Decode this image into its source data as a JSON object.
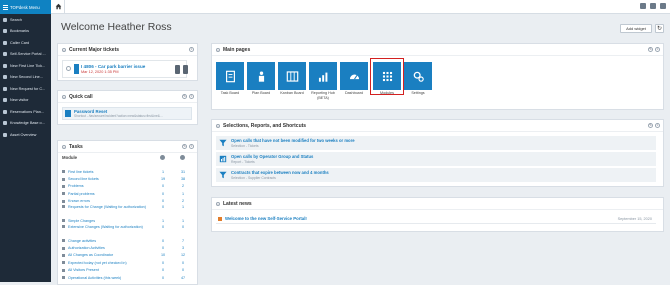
{
  "sidebar": {
    "brand": "TOPdesk Menu",
    "items": [
      {
        "label": "Search",
        "icon": "search-icon"
      },
      {
        "label": "Bookmarks",
        "icon": "bookmark-icon"
      },
      {
        "label": "Caller Card",
        "icon": "card-icon"
      },
      {
        "label": "Self-Service Portal ...",
        "icon": "portal-icon"
      },
      {
        "label": "New First Line Tick...",
        "icon": "ticket-icon"
      },
      {
        "label": "New Second Line...",
        "icon": "ticket-icon"
      },
      {
        "label": "New Request for C...",
        "icon": "request-icon"
      },
      {
        "label": "New visitor",
        "icon": "visitor-icon"
      },
      {
        "label": "Reservations Plan...",
        "icon": "calendar-icon"
      },
      {
        "label": "Knowledge Base o...",
        "icon": "knowledge-icon"
      },
      {
        "label": "Asset Overview",
        "icon": "asset-icon"
      }
    ]
  },
  "header": {
    "title": "Welcome Heather Ross",
    "add_widget": "Add widget"
  },
  "major": {
    "title": "Current Major tickets",
    "ticket_title": "I 4806 - Car park barrier issue",
    "ticket_date": "Mar 12, 2020 1:35 PM"
  },
  "quickcall": {
    "title": "Quick call",
    "item_title": "Password Reset",
    "item_sub": "Shortcut - /tas/secure/incident?action=new&status=firstLine&..."
  },
  "tasks": {
    "title": "Tasks",
    "col_module": "Module",
    "rows": [
      {
        "label": "First line tickets",
        "a": "1",
        "b": "31"
      },
      {
        "label": "Second line tickets",
        "a": "19",
        "b": "38"
      },
      {
        "label": "Problems",
        "a": "0",
        "b": "2"
      },
      {
        "label": "Partial problems",
        "a": "0",
        "b": "1"
      },
      {
        "label": "Known errors",
        "a": "0",
        "b": "2"
      },
      {
        "label": "Requests for Change (Waiting for authorization)",
        "a": "0",
        "b": "1"
      },
      {
        "label": "Simple Changes",
        "a": "1",
        "b": "1"
      },
      {
        "label": "Extensive Changes (Waiting for authorization)",
        "a": "0",
        "b": "0"
      },
      {
        "label": "Change activities",
        "a": "0",
        "b": "7"
      },
      {
        "label": "Authorization Activities",
        "a": "0",
        "b": "3"
      },
      {
        "label": "All Changes as Coordinator",
        "a": "10",
        "b": "12"
      },
      {
        "label": "Expected today (not yet checked in)",
        "a": "0",
        "b": "0"
      },
      {
        "label": "All Visitors Present",
        "a": "0",
        "b": "0"
      },
      {
        "label": "Operational Activities (this week)",
        "a": "0",
        "b": "47"
      }
    ]
  },
  "mainpages": {
    "title": "Main pages",
    "tiles": [
      {
        "label": "Task Board",
        "icon": "task-board-icon"
      },
      {
        "label": "Plan Board",
        "icon": "plan-board-icon"
      },
      {
        "label": "Kanban Board",
        "icon": "kanban-icon"
      },
      {
        "label": "Reporting Hub (BETA)",
        "icon": "chart-icon"
      },
      {
        "label": "Dashboard",
        "icon": "dashboard-icon"
      },
      {
        "label": "Modules",
        "icon": "modules-icon"
      },
      {
        "label": "Settings",
        "icon": "gear-icon"
      }
    ]
  },
  "selections": {
    "title": "Selections, Reports, and Shortcuts",
    "items": [
      {
        "title": "Open calls that have not been modified for two weeks or more",
        "sub": "Selection - Tickets"
      },
      {
        "title": "Open calls by Operator Group and Status",
        "sub": "Report - Tickets"
      },
      {
        "title": "Contracts that expire between now and 4 months",
        "sub": "Selection - Supplier Contracts"
      }
    ]
  },
  "news": {
    "title": "Latest news",
    "item": "Welcome to the new Self-Service Portal!",
    "date": "September 15, 2020"
  },
  "colors": {
    "accent": "#1a7fc1",
    "sidebar": "#1e2a38",
    "highlight": "#d32020"
  }
}
